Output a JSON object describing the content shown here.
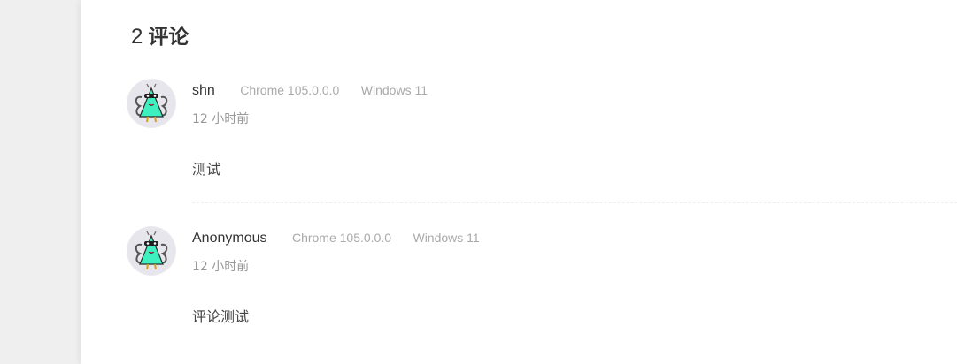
{
  "comments_section": {
    "count": "2",
    "label": "评论"
  },
  "comments": [
    {
      "author": "shn",
      "browser": "Chrome 105.0.0.0",
      "os": "Windows 11",
      "time": "12 小时前",
      "content": "测试",
      "avatar_icon": "robot-avatar-icon"
    },
    {
      "author": "Anonymous",
      "browser": "Chrome 105.0.0.0",
      "os": "Windows 11",
      "time": "12 小时前",
      "content": "评论测试",
      "avatar_icon": "robot-avatar-icon"
    }
  ],
  "colors": {
    "page_bg": "#efefef",
    "panel_bg": "#ffffff",
    "text_primary": "#333333",
    "text_muted": "#aaaaaa",
    "avatar_accent": "#3ef0c0"
  }
}
